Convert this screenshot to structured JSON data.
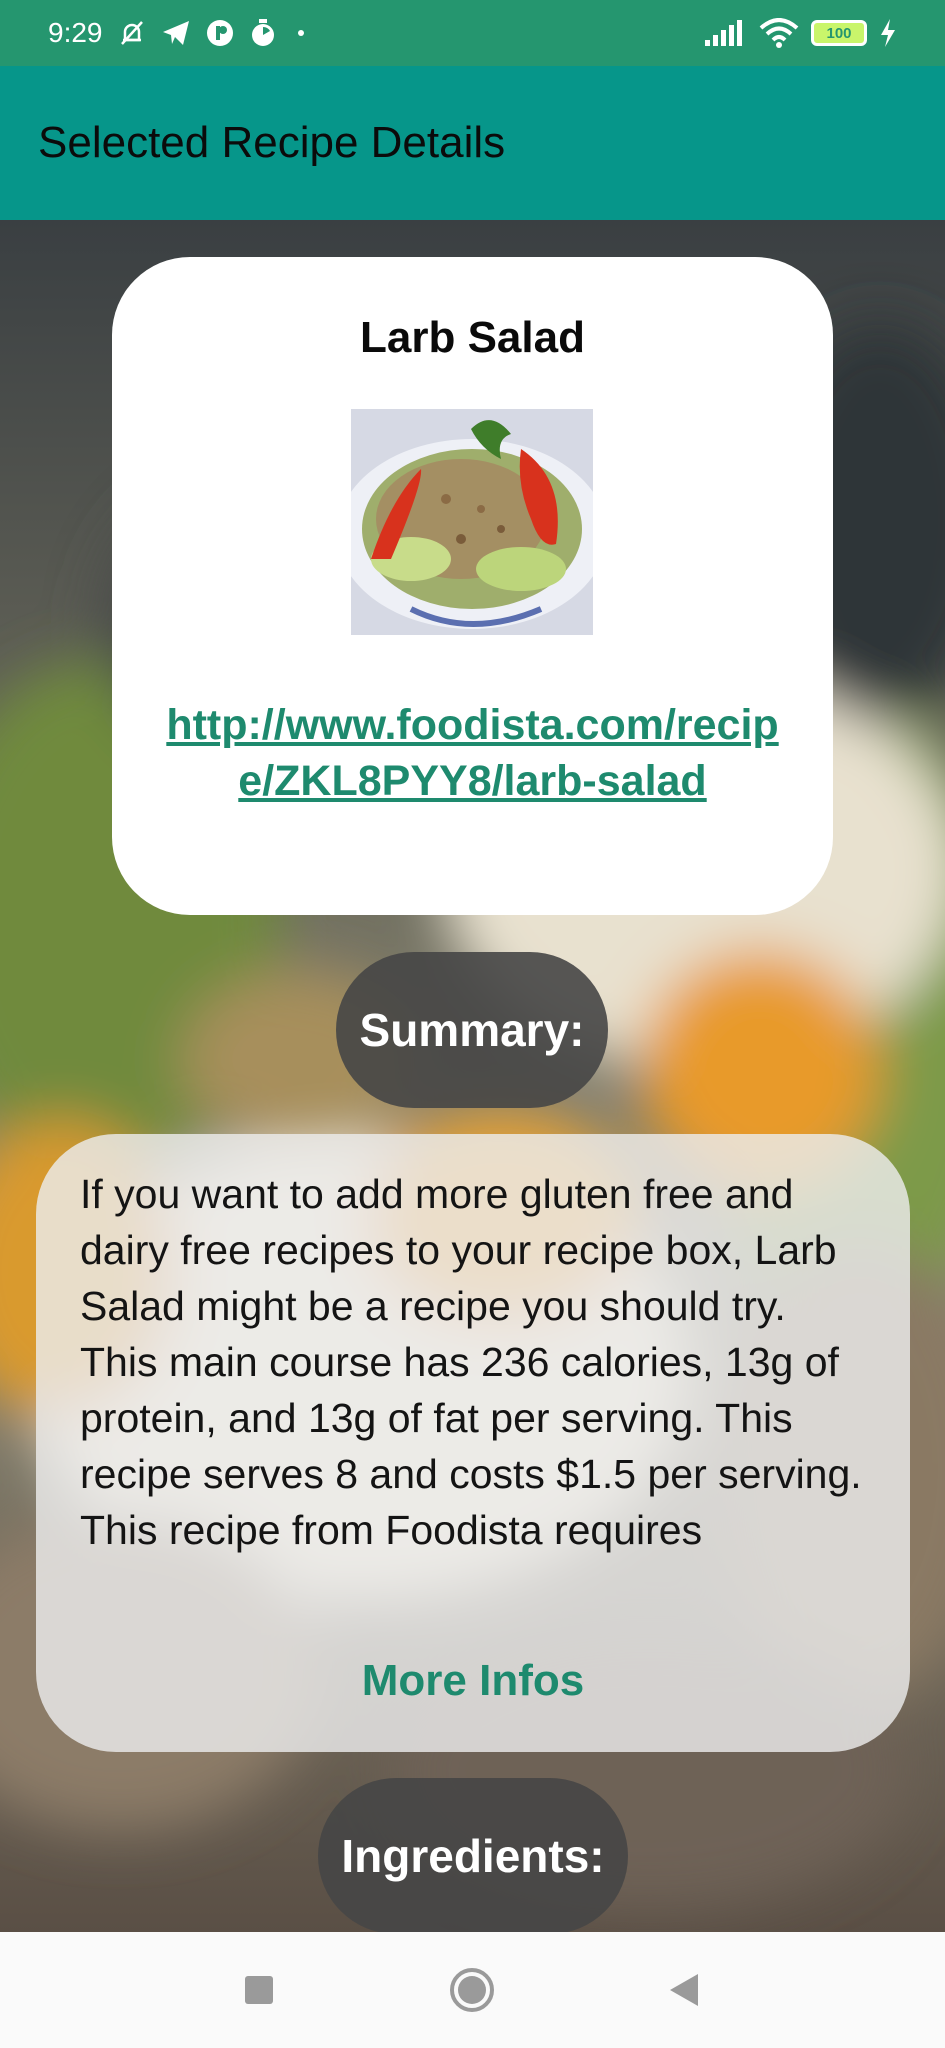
{
  "status_bar": {
    "time": "9:29",
    "battery": "100",
    "icons": [
      "mute-icon",
      "telegram-icon",
      "app-icon",
      "timer-icon",
      "dot-icon",
      "signal-icon",
      "wifi-icon",
      "battery-icon",
      "charging-icon"
    ]
  },
  "app_bar": {
    "title": "Selected Recipe Details"
  },
  "recipe": {
    "title": "Larb Salad",
    "link": "http://www.foodista.com/recipe/ZKL8PYY8/larb-salad"
  },
  "summary": {
    "label": "Summary:",
    "text": "If you want to add more gluten free and dairy free recipes to your recipe box, Larb Salad might be a recipe you should try. This main course has 236 calories, 13g of protein, and 13g of fat per serving. This recipe serves 8 and costs $1.5 per serving. This recipe from Foodista requires",
    "more_label": "More Infos"
  },
  "ingredients": {
    "label": "Ingredients:"
  },
  "nav": {
    "icons": [
      "recent-apps-icon",
      "home-icon",
      "back-icon"
    ]
  },
  "colors": {
    "status_bar": "#25966f",
    "app_bar": "#06968a",
    "link": "#1e8a6e"
  }
}
